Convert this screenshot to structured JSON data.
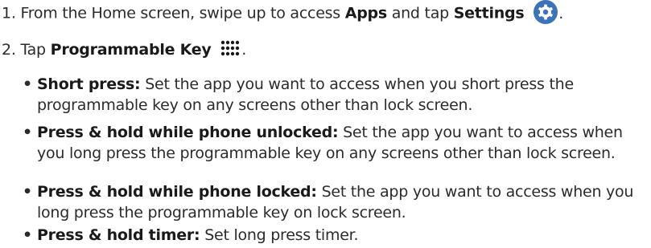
{
  "steps": [
    {
      "number": "1.",
      "text_before": "From the Home screen, swipe up to access ",
      "apps_label": "Apps",
      "text_mid": " and tap ",
      "settings_label": "Settings",
      "icon": "settings-gear-icon",
      "end": "."
    },
    {
      "number": "2.",
      "text_before": "Tap ",
      "key_label": "Programmable Key",
      "icon": "programmable-key-icon",
      "end": "."
    }
  ],
  "bullets": [
    {
      "marker": "•",
      "title": "Short press:",
      "text": "Set the app you want to access when you short press the programmable key on any screens other than lock screen."
    },
    {
      "marker": "•",
      "title": "Press & hold while phone unlocked:",
      "text": "Set the app you want to access when you long press the programmable key on any screens other than lock screen."
    },
    {
      "marker": "•",
      "title": "Press & hold while phone locked:",
      "text": "Set the app you want to access when you long press the programmable key on lock screen."
    },
    {
      "marker": "•",
      "title": "Press & hold timer:",
      "text": "Set long press timer."
    }
  ],
  "colors": {
    "settings_icon_bg": "#3d73b8",
    "text": "#2b2b2b"
  }
}
